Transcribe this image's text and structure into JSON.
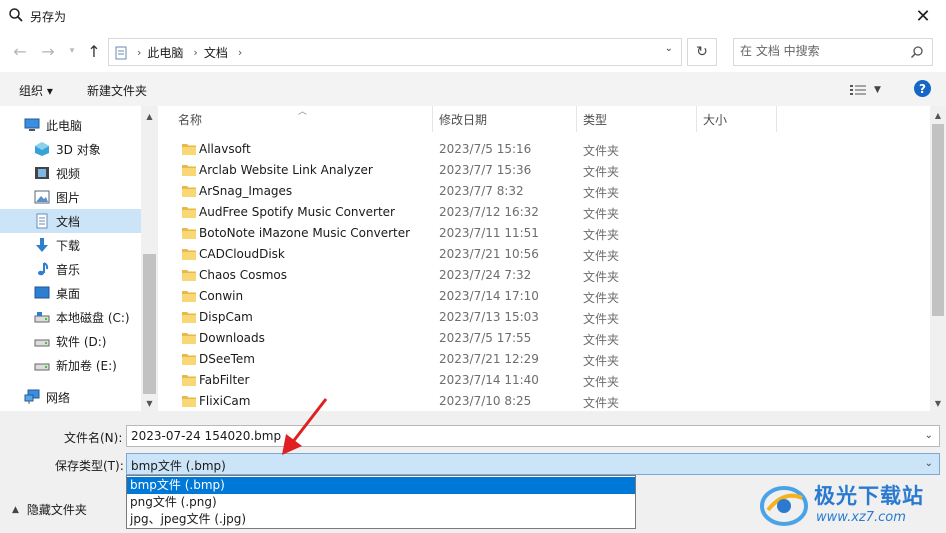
{
  "window": {
    "title": "另存为"
  },
  "address": {
    "crumbs": [
      "此电脑",
      "文档"
    ]
  },
  "search": {
    "placeholder": "在 文档 中搜索"
  },
  "toolbar": {
    "organize": "组织 ▾",
    "new_folder": "新建文件夹"
  },
  "nav": {
    "items": [
      {
        "label": "此电脑",
        "icon": "computer-icon"
      },
      {
        "label": "3D 对象",
        "icon": "3d-objects-icon"
      },
      {
        "label": "视频",
        "icon": "video-icon"
      },
      {
        "label": "图片",
        "icon": "pictures-icon"
      },
      {
        "label": "文档",
        "icon": "documents-icon",
        "selected": true
      },
      {
        "label": "下载",
        "icon": "download-icon"
      },
      {
        "label": "音乐",
        "icon": "music-icon"
      },
      {
        "label": "桌面",
        "icon": "desktop-icon"
      },
      {
        "label": "本地磁盘 (C:)",
        "icon": "drive-c-icon"
      },
      {
        "label": "软件 (D:)",
        "icon": "drive-icon"
      },
      {
        "label": "新加卷 (E:)",
        "icon": "drive-icon"
      },
      {
        "label": "网络",
        "icon": "network-icon"
      }
    ]
  },
  "columns": {
    "name": "名称",
    "date": "修改日期",
    "type": "类型",
    "size": "大小"
  },
  "files": [
    {
      "name": "Allavsoft",
      "date": "2023/7/5 15:16",
      "type": "文件夹"
    },
    {
      "name": "Arclab Website Link Analyzer",
      "date": "2023/7/7 15:36",
      "type": "文件夹"
    },
    {
      "name": "ArSnag_Images",
      "date": "2023/7/7 8:32",
      "type": "文件夹"
    },
    {
      "name": "AudFree Spotify Music Converter",
      "date": "2023/7/12 16:32",
      "type": "文件夹"
    },
    {
      "name": "BotoNote iMazone Music Converter",
      "date": "2023/7/11 11:51",
      "type": "文件夹"
    },
    {
      "name": "CADCloudDisk",
      "date": "2023/7/21 10:56",
      "type": "文件夹"
    },
    {
      "name": "Chaos Cosmos",
      "date": "2023/7/24 7:32",
      "type": "文件夹"
    },
    {
      "name": "Conwin",
      "date": "2023/7/14 17:10",
      "type": "文件夹"
    },
    {
      "name": "DispCam",
      "date": "2023/7/13 15:03",
      "type": "文件夹"
    },
    {
      "name": "Downloads",
      "date": "2023/7/5 17:55",
      "type": "文件夹"
    },
    {
      "name": "DSeeTem",
      "date": "2023/7/21 12:29",
      "type": "文件夹"
    },
    {
      "name": "FabFilter",
      "date": "2023/7/14 11:40",
      "type": "文件夹"
    },
    {
      "name": "FlixiCam",
      "date": "2023/7/10 8:25",
      "type": "文件夹"
    }
  ],
  "bottom": {
    "filename_label": "文件名(N):",
    "filename_value": "2023-07-24 154020.bmp",
    "savetype_label": "保存类型(T):",
    "savetype_value": "bmp文件 (.bmp)",
    "type_options": [
      "bmp文件 (.bmp)",
      "png文件 (.png)",
      "jpg、jpeg文件 (.jpg)"
    ],
    "hide_folders": "隐藏文件夹"
  },
  "watermark": {
    "line1": "极光下载站",
    "line2": "www.xz7.com"
  },
  "colors": {
    "accent": "#0078d7",
    "selection": "#cce4f7",
    "folder": "#f8d775",
    "annotation_arrow": "#e02020"
  }
}
